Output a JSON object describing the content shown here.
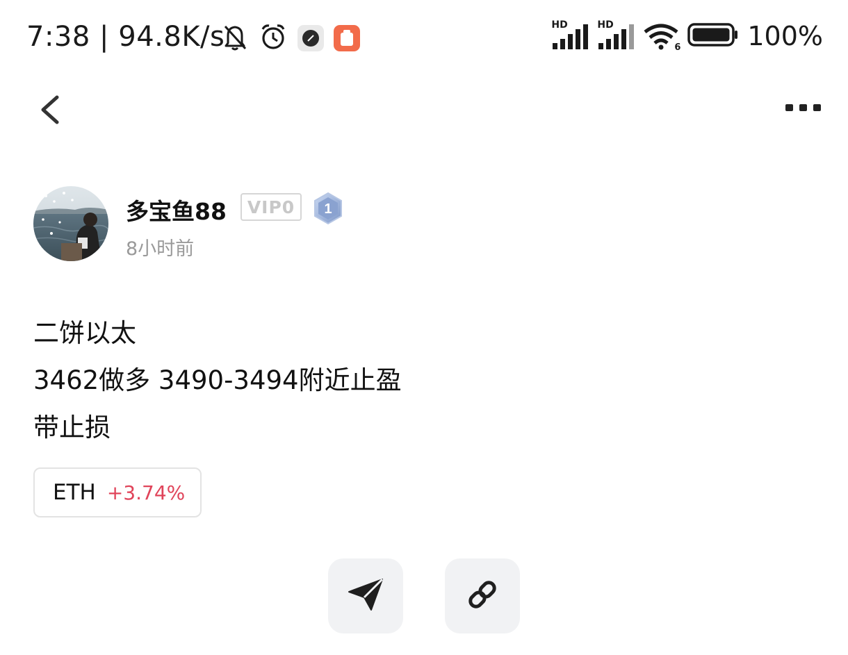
{
  "status_bar": {
    "time": "7:38",
    "net_speed": "94.8K/s",
    "battery": "100%",
    "icons": [
      "bell-off-icon",
      "alarm-clock-icon",
      "app-dark-icon",
      "app-orange-icon",
      "hd-signal-icon",
      "hd-signal-icon",
      "wifi-icon",
      "battery-icon"
    ],
    "signal_label_1": "HD",
    "signal_label_2": "HD",
    "wifi_label": "6"
  },
  "nav": {
    "back_icon": "chevron-left-icon",
    "more_icon": "more-horizontal-icon"
  },
  "author": {
    "name": "多宝鱼88",
    "vip": "VIP0",
    "level": "1",
    "time_ago": "8小时前"
  },
  "post": {
    "lines": [
      "二饼以太",
      "3462做多 3490-3494附近止盈",
      "带止损"
    ]
  },
  "coin_tag": {
    "symbol": "ETH",
    "change": "+3.74%",
    "change_color": "#e0445a"
  },
  "actions": {
    "share_icon": "paper-plane-icon",
    "link_icon": "link-icon"
  },
  "colors": {
    "accent_orange": "#f26b4a",
    "muted_text": "#9a9a9a",
    "button_bg": "#f1f2f4"
  }
}
